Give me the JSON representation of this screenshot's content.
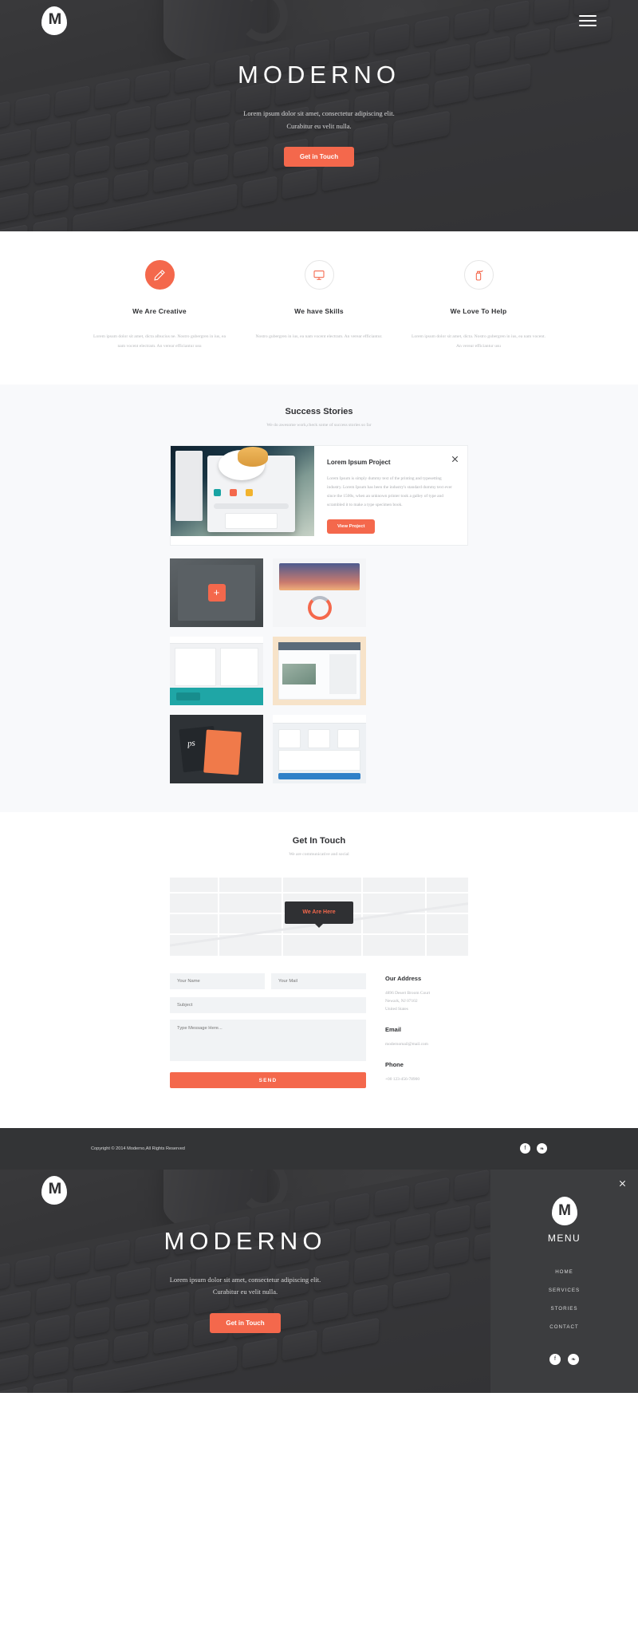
{
  "brand": {
    "logo_letter": "M",
    "name": "MODERNO"
  },
  "hero": {
    "title": "MODERNO",
    "subtitle_line1": "Lorem ipsum dolor sit amet, consectetur adipiscing elit.",
    "subtitle_line2": "Curabitur eu velit nulla.",
    "cta": "Get in Touch",
    "menu_icon": "hamburger-icon"
  },
  "features": [
    {
      "icon": "pencil-icon",
      "title": "We Are Creative",
      "desc": "Lorem ipsum dolor sit amet, dicta albucius ne. Nostro gubergren in ius, ea nam vocent electram. An verear efficiantur usu"
    },
    {
      "icon": "monitor-icon",
      "title": "We have Skills",
      "desc": "Nostro gubergren in ius, ea nam vocent electram. An verear efficiantur."
    },
    {
      "icon": "spray-bottle-icon",
      "title": "We Love To Help",
      "desc": "Lorem ipsum dolor sit amet, dicta. Nostro gubergren in ius, ea nam vocent. An verear efficiantur usu"
    }
  ],
  "stories": {
    "title": "Success Stories",
    "subtitle": "We do awesome work,check some of success stories so far",
    "project": {
      "title": "Lorem Ipsum Project",
      "body": "Lorem Ipsum is simply dummy text of the printing and typesetting industry. Lorem Ipsum has been the industry's standard dummy text ever since the 1500s, when an unknown printer took a galley of type and scrambled it to make a type specimen book.",
      "button": "View Project",
      "close_icon": "close-icon"
    },
    "tiles": [
      {
        "name": "project-tile-1"
      },
      {
        "name": "project-tile-2"
      },
      {
        "name": "project-tile-3"
      },
      {
        "name": "project-tile-4"
      },
      {
        "name": "project-tile-5"
      },
      {
        "name": "project-tile-6"
      }
    ]
  },
  "contact": {
    "title": "Get In Touch",
    "subtitle": "We are communicative and social",
    "map_label": "We Are Here",
    "form": {
      "name_placeholder": "Your Name",
      "mail_placeholder": "Your Mail",
      "subject_placeholder": "Subject",
      "message_placeholder": "Type Message Here...",
      "send_label": "SEND"
    },
    "info": {
      "address_title": "Our Address",
      "address_line1": "4896 Desert Broom Court",
      "address_line2": "Newark, NJ 07102",
      "address_line3": "United States",
      "email_title": "Email",
      "email_value": "modernomail@mail.com",
      "phone_title": "Phone",
      "phone_value": "+00 123-456-78900"
    }
  },
  "footer": {
    "copyright": "Copyright © 2014 Moderno,All Rights Reserved",
    "socials": [
      {
        "icon": "facebook-icon",
        "glyph": "f"
      },
      {
        "icon": "twitter-icon",
        "glyph": "❧"
      }
    ]
  },
  "side_menu": {
    "close_icon": "close-icon",
    "logo_letter": "M",
    "title": "MENU",
    "items": [
      {
        "label": "HOME"
      },
      {
        "label": "SERVICES"
      },
      {
        "label": "STORIES"
      },
      {
        "label": "CONTACT"
      }
    ],
    "socials": [
      {
        "icon": "facebook-icon",
        "glyph": "f"
      },
      {
        "icon": "twitter-icon",
        "glyph": "❧"
      }
    ]
  },
  "colors": {
    "accent": "#f4684c",
    "dark": "#333436",
    "panel_dark": "#3c3d3f"
  }
}
